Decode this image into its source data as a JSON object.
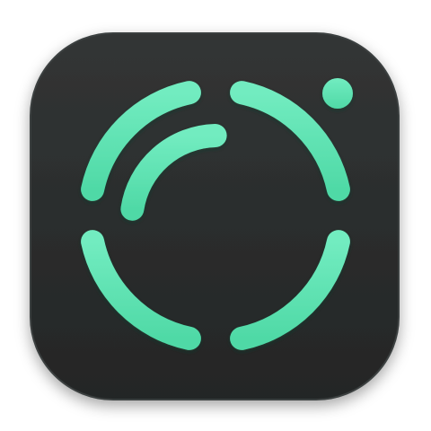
{
  "app_icon": {
    "icon_name": "circular-progress-ring-icon",
    "colors": {
      "tile": "#2a2c2c",
      "tile_edge": "#3a3d3d",
      "accent": "#5ee6b4",
      "accent_highlight": "#8ff3cd",
      "accent_shadow": "#2fa37d"
    }
  }
}
